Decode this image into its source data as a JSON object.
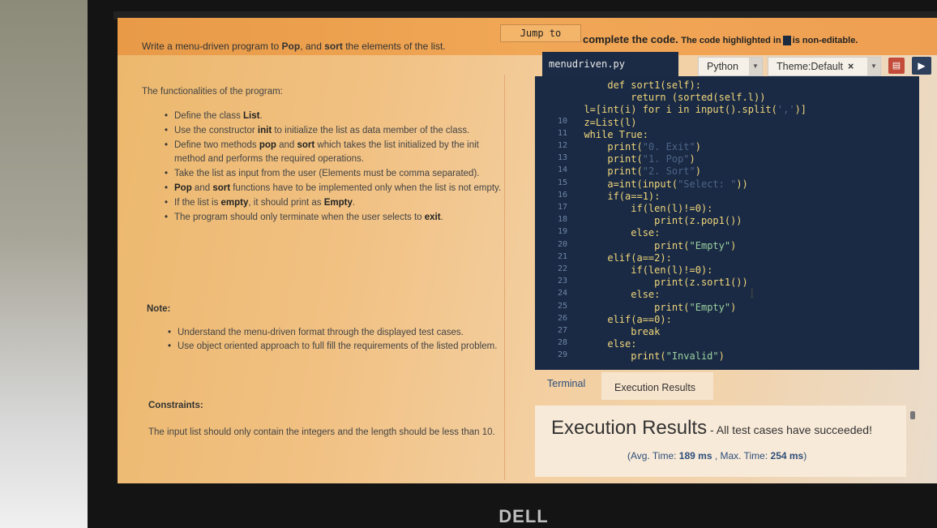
{
  "header": {
    "jump_label": "Jump to",
    "problem_title_pre": "Write a menu-driven program to ",
    "problem_title_pop": "Pop",
    "problem_title_mid": ", and ",
    "problem_title_sort": "sort",
    "problem_title_post": " the elements of the list.",
    "code_instruction": "complete the code.",
    "code_note_pre": "The code highlighted in",
    "code_note_post": "is non-editable."
  },
  "problem": {
    "functionalities_heading": "The functionalities of the program:",
    "bullets": [
      {
        "pre": "Define the class ",
        "bold": "List",
        "post": "."
      },
      {
        "pre": "Use the constructor ",
        "bold": "init",
        "post": " to initialize the list as data member of the class."
      },
      {
        "pre": "Define two methods ",
        "bold": "pop",
        "mid": " and ",
        "bold2": "sort",
        "post": " which takes the list initialized by the init method and performs the required operations."
      },
      {
        "pre": "Take the list as input from the user (Elements must be comma separated)."
      },
      {
        "bold": "Pop",
        "mid": " and ",
        "bold2": "sort",
        "post": " functions have to be implemented only when the list is not empty."
      },
      {
        "pre": "If the list is ",
        "bold": "empty",
        "post": ", it should print as ",
        "bold3": "Empty",
        "tail": "."
      },
      {
        "pre": "The program should only terminate when the user selects to ",
        "bold": "exit",
        "post": "."
      }
    ],
    "note_heading": "Note:",
    "notes": [
      "Understand the menu-driven format through the displayed test cases.",
      "Use object oriented approach to full fill the requirements of the listed problem."
    ],
    "constraints_heading": "Constraints:",
    "constraints_text": "The input list should only contain the integers and the length should be less than 10."
  },
  "editor": {
    "filename": "menudriven.py",
    "language": "Python",
    "theme": "Theme:Default",
    "theme_clear": "×",
    "lines": [
      {
        "n": "",
        "indent": "      ",
        "segs": [
          {
            "t": "def sort1(self):",
            "c": "kw"
          }
        ]
      },
      {
        "n": "",
        "indent": "          ",
        "segs": [
          {
            "t": "return (sorted(self.l))",
            "c": "kw"
          }
        ]
      },
      {
        "n": "",
        "indent": "  ",
        "segs": [
          {
            "t": "l=[int(i) for i in input().split(",
            "c": "kw"
          },
          {
            "t": "','",
            "c": "dim"
          },
          {
            "t": ")]",
            "c": "kw"
          }
        ]
      },
      {
        "n": "10",
        "indent": "  ",
        "segs": [
          {
            "t": "z=List(l)",
            "c": "kw"
          }
        ]
      },
      {
        "n": "11",
        "indent": "  ",
        "segs": [
          {
            "t": "while True:",
            "c": "kw"
          }
        ]
      },
      {
        "n": "12",
        "indent": "      ",
        "segs": [
          {
            "t": "print(",
            "c": "kw"
          },
          {
            "t": "\"0. Exit\"",
            "c": "dim"
          },
          {
            "t": ")",
            "c": "kw"
          }
        ]
      },
      {
        "n": "13",
        "indent": "      ",
        "segs": [
          {
            "t": "print(",
            "c": "kw"
          },
          {
            "t": "\"1. Pop\"",
            "c": "dim"
          },
          {
            "t": ")",
            "c": "kw"
          }
        ]
      },
      {
        "n": "14",
        "indent": "      ",
        "segs": [
          {
            "t": "print(",
            "c": "kw"
          },
          {
            "t": "\"2. Sort\"",
            "c": "dim"
          },
          {
            "t": ")",
            "c": "kw"
          }
        ]
      },
      {
        "n": "15",
        "indent": "      ",
        "segs": [
          {
            "t": "a=int(input(",
            "c": "kw"
          },
          {
            "t": "\"Select: \"",
            "c": "dim"
          },
          {
            "t": "))",
            "c": "kw"
          }
        ]
      },
      {
        "n": "16",
        "indent": "      ",
        "segs": [
          {
            "t": "if(a==1):",
            "c": "kw"
          }
        ]
      },
      {
        "n": "17",
        "indent": "          ",
        "segs": [
          {
            "t": "if(len(l)!=0):",
            "c": "kw"
          }
        ]
      },
      {
        "n": "18",
        "indent": "              ",
        "segs": [
          {
            "t": "print(z.pop1())",
            "c": "kw"
          }
        ]
      },
      {
        "n": "19",
        "indent": "          ",
        "segs": [
          {
            "t": "else:",
            "c": "kw"
          }
        ]
      },
      {
        "n": "20",
        "indent": "              ",
        "segs": [
          {
            "t": "print(",
            "c": "kw"
          },
          {
            "t": "\"Empty\"",
            "c": "str"
          },
          {
            "t": ")",
            "c": "kw"
          }
        ]
      },
      {
        "n": "21",
        "indent": "      ",
        "segs": [
          {
            "t": "elif(a==2):",
            "c": "kw"
          }
        ]
      },
      {
        "n": "22",
        "indent": "          ",
        "segs": [
          {
            "t": "if(len(l)!=0):",
            "c": "kw"
          }
        ]
      },
      {
        "n": "23",
        "indent": "              ",
        "segs": [
          {
            "t": "print(z.sort1())",
            "c": "kw"
          }
        ]
      },
      {
        "n": "24",
        "indent": "          ",
        "segs": [
          {
            "t": "else:",
            "c": "kw"
          }
        ]
      },
      {
        "n": "25",
        "indent": "              ",
        "segs": [
          {
            "t": "print(",
            "c": "kw"
          },
          {
            "t": "\"Empty\"",
            "c": "str"
          },
          {
            "t": ")",
            "c": "kw"
          }
        ]
      },
      {
        "n": "26",
        "indent": "      ",
        "segs": [
          {
            "t": "elif(a==0):",
            "c": "kw"
          }
        ]
      },
      {
        "n": "27",
        "indent": "          ",
        "segs": [
          {
            "t": "break",
            "c": "kw"
          }
        ]
      },
      {
        "n": "28",
        "indent": "      ",
        "segs": [
          {
            "t": "else:",
            "c": "kw"
          }
        ]
      },
      {
        "n": "29",
        "indent": "          ",
        "segs": [
          {
            "t": "print(",
            "c": "kw"
          },
          {
            "t": "\"Invalid\"",
            "c": "str"
          },
          {
            "t": ")",
            "c": "kw"
          }
        ]
      }
    ]
  },
  "results": {
    "tab_terminal": "Terminal",
    "tab_execution": "Execution Results",
    "title": "Execution Results",
    "status": " - All test cases have succeeded!",
    "time_pre": "(Avg. Time: ",
    "avg_time": "189 ms",
    "time_mid": " , Max. Time: ",
    "max_time": "254 ms",
    "time_post": ")"
  },
  "device": {
    "brand": "DELL"
  },
  "colors": {
    "editor_bg": "#1a2a44",
    "code_text": "#f0d67a",
    "string_text": "#9bd1a0",
    "topbar": "#f0a756"
  }
}
